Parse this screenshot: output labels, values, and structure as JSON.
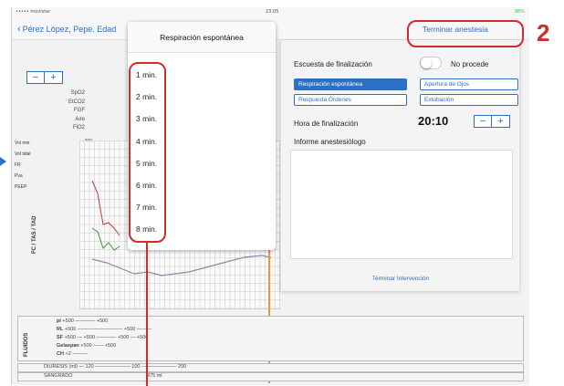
{
  "status_bar": {
    "carrier": "••••• movistar",
    "clock": "23:05",
    "battery": "98%"
  },
  "nav": {
    "back_label": "Pérez López, Pepe. Edad",
    "terminate_anesthesia": "Terminar anestesia"
  },
  "zoom": {
    "minus": "−",
    "plus": "+"
  },
  "params": [
    "SpO2",
    "EtCO2",
    "FGF",
    "Aire",
    "FiO2"
  ],
  "vitals": [
    "Vol min",
    "Vol tidal",
    "FR",
    "Pva",
    "PEEP"
  ],
  "y_ticks": [
    "200",
    "190",
    "180",
    "170",
    "160",
    "150",
    "140",
    "130",
    "120",
    "110",
    "100",
    "90",
    "80",
    "70",
    "60",
    "50",
    "40",
    "30",
    "20",
    "10"
  ],
  "side_label": "FC / TAS / TAD",
  "fluids": {
    "label": "FLUIDOS",
    "rows": [
      {
        "name": "pl",
        "marks": "+500 ———— +500"
      },
      {
        "name": "RL",
        "marks": "+500 ————————— +500 ———"
      },
      {
        "name": "SF",
        "marks": "+500 — +500 ———— +500 — +500"
      },
      {
        "name": "Gelaspan",
        "marks": "+500 —— +500"
      },
      {
        "name": "CH",
        "marks": "+2 ———"
      }
    ],
    "diuresis_label": "DIURESIS (ml)",
    "diuresis_marks": "— 120 ——————— 100 ——————— 200",
    "bleeding_label": "SANGRADO",
    "bleeding_value": "475 ml"
  },
  "popover": {
    "title": "Respiración espontánea",
    "items": [
      "1 min.",
      "2 min.",
      "3 min.",
      "4 min.",
      "5 min.",
      "6 min.",
      "7 min.",
      "8 min."
    ]
  },
  "end_panel": {
    "scale_label": "Escuesta de finalización",
    "no_procede": "No procede",
    "btn_respiracion": "Respiración espontánea",
    "btn_apertura": "Apertura de Ojos",
    "btn_respuesta": "Respuesta Órdenes",
    "btn_extubacion": "Extubación",
    "time_label": "Hora de finalización",
    "time_value": "20:10",
    "stepper_minus": "−",
    "stepper_plus": "+",
    "report_label": "Informe anestesiólogo",
    "end_intervention": "Terminar Intervención"
  },
  "annotation": {
    "number": "2"
  },
  "colors": {
    "accent": "#2d6fc3",
    "annotation_red": "#d42a2a",
    "timeline_orange": "#e59a4a"
  }
}
